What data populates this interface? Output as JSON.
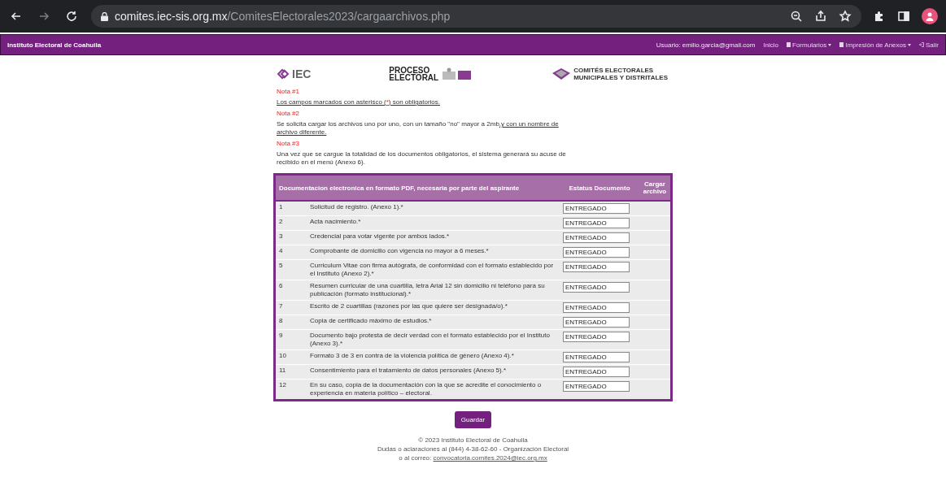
{
  "browser": {
    "url_host": "comites.iec-sis.org.mx",
    "url_path": "/ComitesElectorales2023/cargaarchivos.php",
    "forward_disabled": true
  },
  "navbar": {
    "brand": "Instituto Electoral de Coahuila",
    "user": "Usuario: emilio.garcia@gmail.com",
    "items": [
      {
        "label": "Inicio",
        "kind": "link"
      },
      {
        "label": "Formularios",
        "kind": "dropdown"
      },
      {
        "label": "Impresión de Anexos",
        "kind": "dropdown"
      },
      {
        "label": "Salir",
        "kind": "logout"
      }
    ]
  },
  "logos": {
    "iec": "IEC",
    "proceso": [
      "PROCESO",
      "ELECTORAL"
    ],
    "comites": [
      "COMITÉS ELECTORALES",
      "MUNICIPALES Y DISTRITALES"
    ]
  },
  "notes": [
    {
      "title": "Nota #1",
      "parts": [
        {
          "text": "Los campos marcados con asterisco (",
          "kind": "underline"
        },
        {
          "text": "*",
          "kind": "red"
        },
        {
          "text": ") son obligatorios.",
          "kind": "underline"
        }
      ]
    },
    {
      "title": "Nota #2",
      "parts": [
        {
          "text": "Se solicita cargar los archivos uno por uno, con un tamaño \"no\" mayor a 2mb",
          "kind": "plain"
        },
        {
          "text": ",y con un nombre de archivo diferente.",
          "kind": "underline"
        }
      ]
    },
    {
      "title": "Nota #3",
      "parts": [
        {
          "text": "Una vez que se cargue la totalidad de los documentos obligatorios, el sistema generará su acuse de recibido en el menú (Anexo 6).",
          "kind": "plain"
        }
      ]
    }
  ],
  "table": {
    "columns": [
      "Documentacion electronica en formato PDF, necesaria por parte del aspirante",
      "Estatus Documento",
      "Cargar archivo"
    ],
    "rows": [
      {
        "number": "1",
        "document": "Solicitud de registro. (Anexo 1).*",
        "status": "ENTREGADO"
      },
      {
        "number": "2",
        "document": "Acta nacimiento.*",
        "status": "ENTREGADO"
      },
      {
        "number": "3",
        "document": "Credencial para votar vigente por ambos lados.*",
        "status": "ENTREGADO"
      },
      {
        "number": "4",
        "document": "Comprobante de domicilio con vigencia no mayor a 6 meses.*",
        "status": "ENTREGADO"
      },
      {
        "number": "5",
        "document": "Curriculum Vitae con firma autógrafa, de conformidad con el formato establecido por el Instituto (Anexo 2).*",
        "status": "ENTREGADO"
      },
      {
        "number": "6",
        "document": "Resumen curricular de una cuartilla, letra Arial 12 sin domicilio ni teléfono para su publicación (formato institucional).*",
        "status": "ENTREGADO"
      },
      {
        "number": "7",
        "document": "Escrito de 2 cuartillas (razones por las que quiere ser designada/o).*",
        "status": "ENTREGADO"
      },
      {
        "number": "8",
        "document": "Copia de certificado máximo de estudios.*",
        "status": "ENTREGADO"
      },
      {
        "number": "9",
        "document": "Documento bajo protesta de decir verdad con el formato establecido por el Instituto (Anexo 3).*",
        "status": "ENTREGADO"
      },
      {
        "number": "10",
        "document": "Formato 3 de 3 en contra de la violencia política de género (Anexo 4).*",
        "status": "ENTREGADO"
      },
      {
        "number": "11",
        "document": "Consentimiento para el tratamiento de datos personales (Anexo 5).*",
        "status": "ENTREGADO"
      },
      {
        "number": "12",
        "document": "En su caso, copia de la documentación con la que se acredite el conocimiento o experiencia en materia político – electoral.",
        "status": "ENTREGADO"
      }
    ]
  },
  "save_button": "Guardar",
  "footer": {
    "copyright": "© 2023 Instituto Electoral de Coahuila",
    "contact": "Dudas o aclaraciones al (844) 4-38-62-60 - Organización Electoral",
    "email_prefix": "o al correo:",
    "email": "convocatoria.comites.2024@iec.org.mx"
  }
}
